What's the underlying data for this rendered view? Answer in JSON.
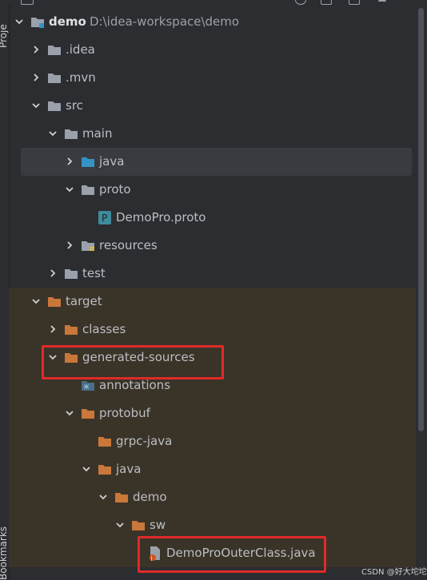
{
  "tool_window": {
    "side_top_label": "Proje",
    "side_bottom_label": "Bookmarks"
  },
  "tree": {
    "rows": [
      {
        "key": "demo",
        "label": "demo",
        "path": "D:\\idea-workspace\\demo",
        "depth": 0,
        "expanded": true,
        "icon": "module-folder-icon",
        "tone": "normal",
        "bold": true
      },
      {
        "key": "idea",
        "label": ".idea",
        "depth": 1,
        "expanded": false,
        "icon": "folder-icon",
        "tone": "normal"
      },
      {
        "key": "mvn",
        "label": ".mvn",
        "depth": 1,
        "expanded": false,
        "icon": "folder-icon",
        "tone": "normal"
      },
      {
        "key": "src",
        "label": "src",
        "depth": 1,
        "expanded": true,
        "icon": "folder-icon",
        "tone": "normal"
      },
      {
        "key": "main",
        "label": "main",
        "depth": 2,
        "expanded": true,
        "icon": "folder-icon",
        "tone": "normal"
      },
      {
        "key": "java",
        "label": "java",
        "depth": 3,
        "expanded": false,
        "icon": "source-root-folder-icon",
        "tone": "normal",
        "selected": true
      },
      {
        "key": "proto",
        "label": "proto",
        "depth": 3,
        "expanded": true,
        "icon": "folder-icon",
        "tone": "normal"
      },
      {
        "key": "demopro",
        "label": "DemoPro.proto",
        "depth": 4,
        "icon": "proto-file-icon",
        "tone": "normal",
        "leaf": true
      },
      {
        "key": "resources",
        "label": "resources",
        "depth": 3,
        "expanded": false,
        "icon": "resources-folder-icon",
        "tone": "normal"
      },
      {
        "key": "test",
        "label": "test",
        "depth": 2,
        "expanded": false,
        "icon": "folder-icon",
        "tone": "normal"
      },
      {
        "key": "target",
        "label": "target",
        "depth": 1,
        "expanded": true,
        "icon": "excluded-folder-icon",
        "tone": "excluded"
      },
      {
        "key": "classes",
        "label": "classes",
        "depth": 2,
        "expanded": false,
        "icon": "excluded-folder-icon",
        "tone": "excluded"
      },
      {
        "key": "generated",
        "label": "generated-sources",
        "depth": 2,
        "expanded": true,
        "icon": "excluded-folder-icon",
        "tone": "excluded",
        "highlighted": true
      },
      {
        "key": "annotations",
        "label": "annotations",
        "depth": 3,
        "icon": "generated-source-folder-icon",
        "tone": "excluded",
        "leaf": true
      },
      {
        "key": "protobuf",
        "label": "protobuf",
        "depth": 3,
        "expanded": true,
        "icon": "excluded-folder-icon",
        "tone": "excluded"
      },
      {
        "key": "grpcjava",
        "label": "grpc-java",
        "depth": 4,
        "icon": "excluded-folder-icon",
        "tone": "excluded",
        "leaf": true
      },
      {
        "key": "java2",
        "label": "java",
        "depth": 4,
        "expanded": true,
        "icon": "excluded-folder-icon",
        "tone": "excluded"
      },
      {
        "key": "demo2",
        "label": "demo",
        "depth": 5,
        "expanded": true,
        "icon": "excluded-folder-icon",
        "tone": "excluded"
      },
      {
        "key": "sw",
        "label": "sw",
        "depth": 6,
        "expanded": true,
        "icon": "excluded-folder-icon",
        "tone": "excluded"
      },
      {
        "key": "outer",
        "label": "DemoProOuterClass.java",
        "depth": 7,
        "icon": "java-class-file-icon",
        "tone": "excluded",
        "leaf": true,
        "highlighted": true
      }
    ]
  },
  "watermark": "CSDN @好大坨坨",
  "colors": {
    "background": "#2b2d30",
    "excluded_band": "#3a3428",
    "selected_band": "#393b40",
    "excluded_folder": "#c9773a",
    "folder": "#9aa1ab",
    "source_root": "#3592c4",
    "highlight": "#e02a2a"
  }
}
